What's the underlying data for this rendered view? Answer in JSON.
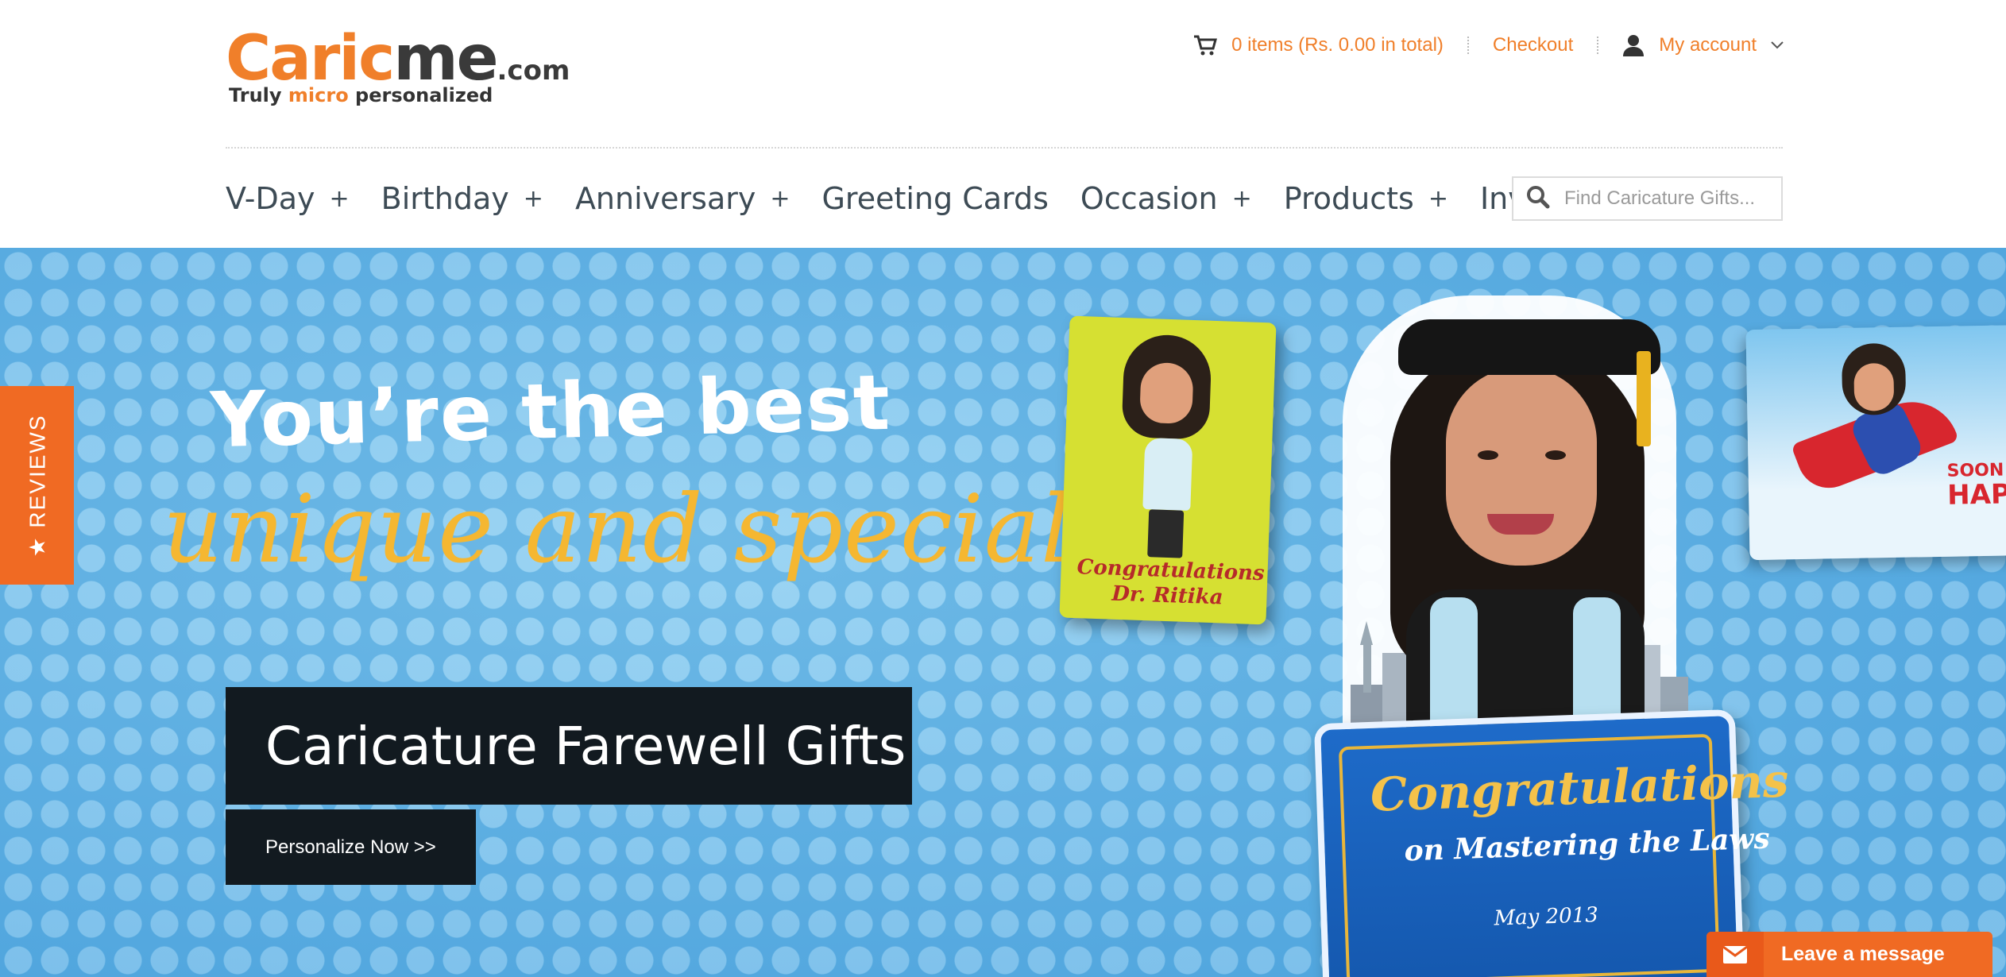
{
  "brand": {
    "logo_part1": "Caric",
    "logo_part2": "me",
    "logo_domain": ".com",
    "tagline_start": "Truly ",
    "tagline_mid": "micro",
    "tagline_end": " personalized",
    "accent_color": "#f07f2a"
  },
  "header": {
    "cart_label": "0 items (Rs. 0.00 in total)",
    "checkout_label": "Checkout",
    "account_label": "My account"
  },
  "nav": {
    "items": [
      {
        "label": "V-Day",
        "expand": "+"
      },
      {
        "label": "Birthday",
        "expand": "+"
      },
      {
        "label": "Anniversary",
        "expand": "+"
      },
      {
        "label": "Greeting Cards",
        "expand": ""
      },
      {
        "label": "Occasion",
        "expand": "+"
      },
      {
        "label": "Products",
        "expand": "+"
      },
      {
        "label": "Invites",
        "expand": ""
      }
    ]
  },
  "search": {
    "placeholder": "Find Caricature Gifts...",
    "value": ""
  },
  "hero": {
    "headline_line1": "You’re the best",
    "headline_line2": "unique and special",
    "promo_title": "Caricature Farewell Gifts",
    "cta_label": "Personalize Now >>",
    "card_left_text1": "Congratulations",
    "card_left_text2": "Dr. Ritika",
    "card_right_text1": "SOON",
    "card_right_text2": "HAP",
    "sign_line1": "Congratulations",
    "sign_line2": "on Mastering the Laws",
    "sign_line3": "May 2013"
  },
  "reviews_tab": {
    "label": "★ REVIEWS"
  },
  "chat": {
    "label": "Leave a message"
  },
  "icons": [
    "cart-icon",
    "user-icon",
    "chevron-down-icon",
    "search-icon",
    "mail-icon"
  ]
}
